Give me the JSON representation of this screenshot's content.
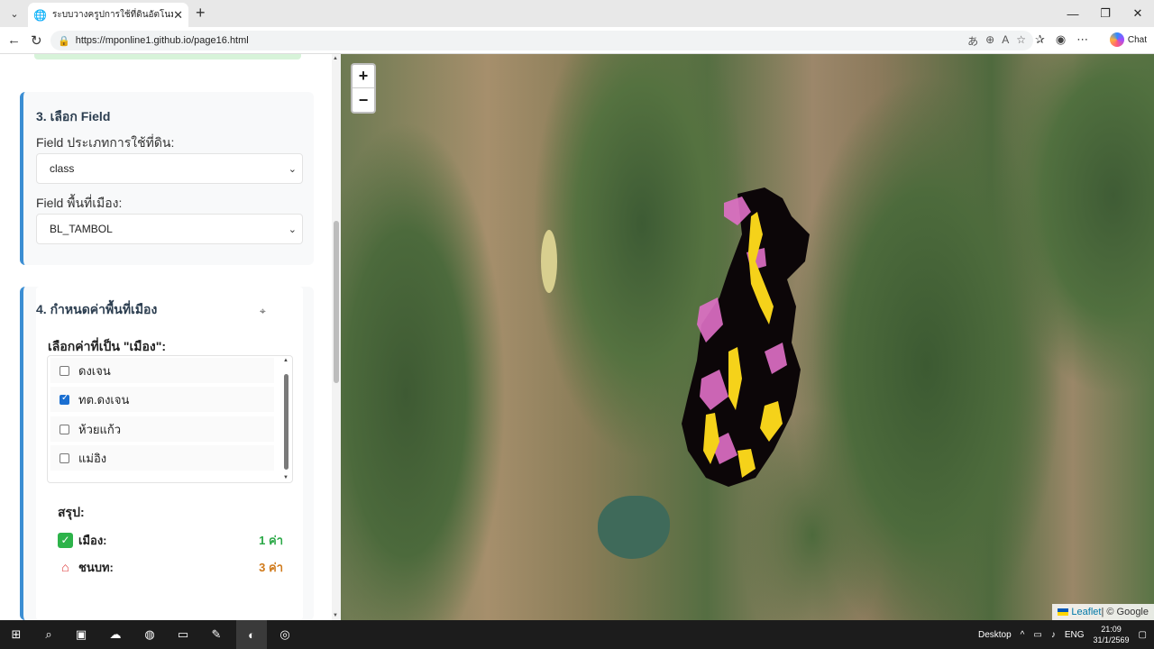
{
  "browser": {
    "tab_title": "ระบบวางครูปการใช้ที่ดินอัตโนมัติ",
    "url": "https://mponline1.github.io/page16.html",
    "chat_label": "Chat"
  },
  "panel": {
    "section3": {
      "title": "3. เลือก Field",
      "landuse_label": "Field ประเภทการใช้ที่ดิน:",
      "landuse_value": "class",
      "urban_label": "Field พื้นที่เมือง:",
      "urban_value": "BL_TAMBOL"
    },
    "section4": {
      "title": "4. กำหนดค่าพื้นที่เมือง",
      "select_label": "เลือกค่าที่เป็น \"เมือง\":",
      "options": [
        {
          "label": "ดงเจน",
          "checked": false
        },
        {
          "label": "ทต.ดงเจน",
          "checked": true
        },
        {
          "label": "ห้วยแก้ว",
          "checked": false
        },
        {
          "label": "แม่อิง",
          "checked": false
        }
      ],
      "summary_title": "สรุป:",
      "urban_summary_label": "เมือง:",
      "urban_summary_value": "1 ค่า",
      "rural_summary_label": "ชนบท:",
      "rural_summary_value": "3 ค่า"
    }
  },
  "map": {
    "zoom_in": "+",
    "zoom_out": "−",
    "attribution_leaflet": "Leaflet",
    "attribution_sep": " | © Google"
  },
  "taskbar": {
    "desktop_label": "Desktop",
    "lang": "ENG",
    "time": "21:09",
    "date": "31/1/2569"
  },
  "colors": {
    "accent": "#3b8ed3",
    "urban_count": "#2aa846",
    "rural_count": "#d07a1b",
    "burn_pink": "#e070c8",
    "burn_yellow": "#f5d21a"
  }
}
